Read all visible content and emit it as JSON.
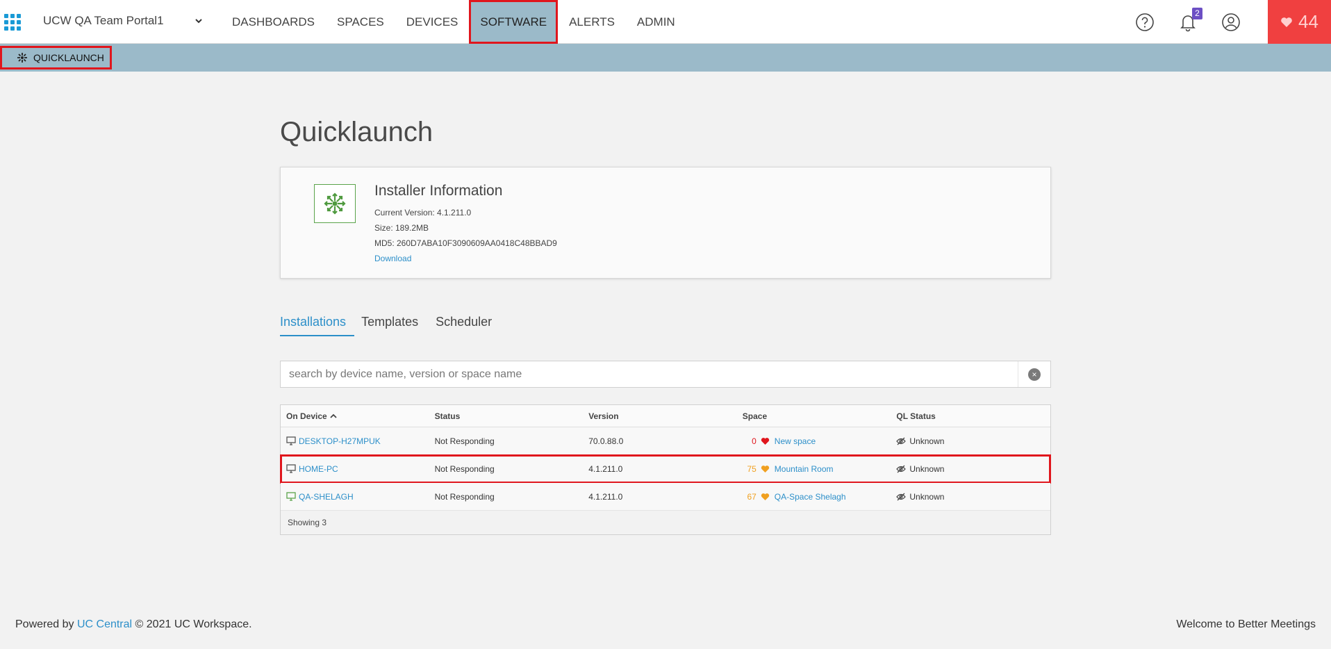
{
  "header": {
    "portal_name": "UCW QA Team Portal1",
    "nav": [
      "DASHBOARDS",
      "SPACES",
      "DEVICES",
      "SOFTWARE",
      "ALERTS",
      "ADMIN"
    ],
    "active_nav": "SOFTWARE",
    "notifications_count": "2",
    "health_score": "44",
    "health_color": "#f04040",
    "icons": [
      "apps-grid-icon",
      "chevron-down-icon",
      "help-icon",
      "bell-icon",
      "user-icon",
      "heart-icon"
    ]
  },
  "subnav": {
    "label": "QUICKLAUNCH",
    "icon": "quicklaunch-icon"
  },
  "page": {
    "title": "Quicklaunch"
  },
  "installer": {
    "title": "Installer Information",
    "current_version": "Current Version: 4.1.211.0",
    "size": "Size: 189.2MB",
    "md5": "MD5: 260D7ABA10F3090609AA0418C48BBAD9",
    "download_label": "Download"
  },
  "tabs": [
    "Installations",
    "Templates",
    "Scheduler"
  ],
  "active_tab": "Installations",
  "search": {
    "placeholder": "search by device name, version or space name",
    "value": "",
    "clear_label": "×"
  },
  "table": {
    "columns": [
      "On Device",
      "Status",
      "Version",
      "Space",
      "QL Status"
    ],
    "sort_column": "On Device",
    "sort_direction": "asc",
    "rows": [
      {
        "device": "DESKTOP-H27MPUK",
        "device_icon_color": "#555555",
        "status": "Not Responding",
        "version": "70.0.88.0",
        "space_score": "0",
        "space_score_color": "#e0161d",
        "space_name": "New space",
        "ql_status": "Unknown"
      },
      {
        "device": "HOME-PC",
        "device_icon_color": "#555555",
        "status": "Not Responding",
        "version": "4.1.211.0",
        "space_score": "75",
        "space_score_color": "#f0a020",
        "space_name": "Mountain Room",
        "ql_status": "Unknown"
      },
      {
        "device": "QA-SHELAGH",
        "device_icon_color": "#5aa34a",
        "status": "Not Responding",
        "version": "4.1.211.0",
        "space_score": "67",
        "space_score_color": "#f0a020",
        "space_name": "QA-Space Shelagh",
        "ql_status": "Unknown"
      }
    ],
    "footer": "Showing 3"
  },
  "footer": {
    "powered_by": "Powered by",
    "link_text": "UC Central",
    "copyright": "© 2021 UC Workspace.",
    "right_text": "Welcome to Better Meetings"
  },
  "colors": {
    "accent": "#2c8fc9",
    "subbar": "#9bbac9",
    "highlight": "#e0161d"
  }
}
